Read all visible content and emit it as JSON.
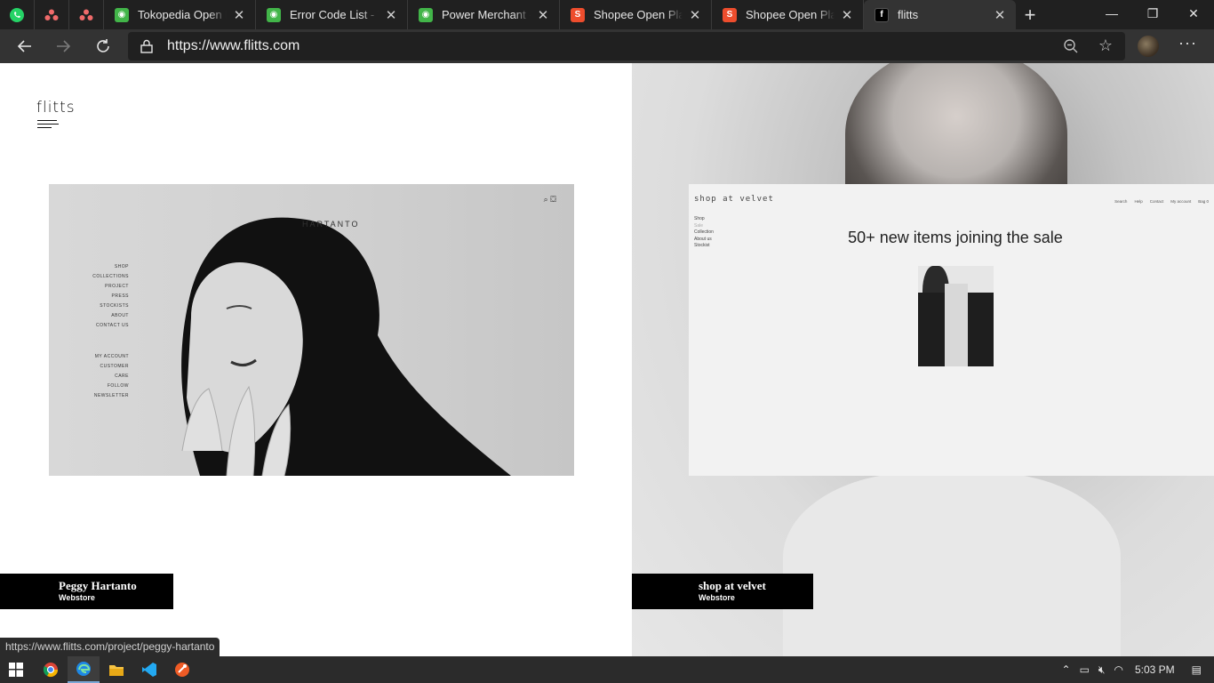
{
  "browser": {
    "pinned_tabs": [
      {
        "icon": "whatsapp-icon"
      },
      {
        "icon": "asana-icon"
      },
      {
        "icon": "asana-icon"
      }
    ],
    "tabs": [
      {
        "title": "Tokopedia Open Pla",
        "icon": "tokopedia-icon",
        "color": "#42b549"
      },
      {
        "title": "Error Code List - Tok",
        "icon": "tokopedia-icon",
        "color": "#42b549"
      },
      {
        "title": "Power Merchant - F",
        "icon": "tokopedia-icon",
        "color": "#42b549"
      },
      {
        "title": "Shopee Open Platfo",
        "icon": "shopee-icon",
        "color": "#ee4d2d"
      },
      {
        "title": "Shopee Open Platfo",
        "icon": "shopee-icon",
        "color": "#ee4d2d"
      },
      {
        "title": "flitts",
        "icon": "flitts-icon",
        "color": "#000000",
        "active": true
      }
    ],
    "url": "https://www.flitts.com",
    "status_url": "https://www.flitts.com/project/peggy-hartanto"
  },
  "site": {
    "logo": "flitts",
    "projects": [
      {
        "caption": {
          "name": "Peggy Hartanto",
          "type": "Webstore"
        },
        "preview": {
          "brand": "HARTANTO",
          "menu": [
            "SHOP",
            "COLLECTIONS",
            "PROJECT",
            "PRESS",
            "STOCKISTS",
            "ABOUT",
            "CONTACT US"
          ],
          "menu2": [
            "MY ACCOUNT",
            "CUSTOMER CARE",
            "FOLLOW",
            "NEWSLETTER"
          ]
        }
      },
      {
        "caption": {
          "name": "shop at velvet",
          "type": "Webstore"
        },
        "preview": {
          "brand": "shop at velvet",
          "top_nav": [
            "Search",
            "Help",
            "Contact",
            "My account",
            "Bag 0"
          ],
          "side_nav": [
            "Shop",
            "Sale",
            "Collection",
            "About us",
            "Stockist"
          ],
          "headline": "50+ new items joining the sale"
        }
      }
    ]
  },
  "taskbar": {
    "apps": [
      "windows-start-icon",
      "chrome-icon",
      "edge-icon",
      "file-explorer-icon",
      "vscode-icon",
      "postman-icon"
    ],
    "time": "5:03 PM"
  }
}
